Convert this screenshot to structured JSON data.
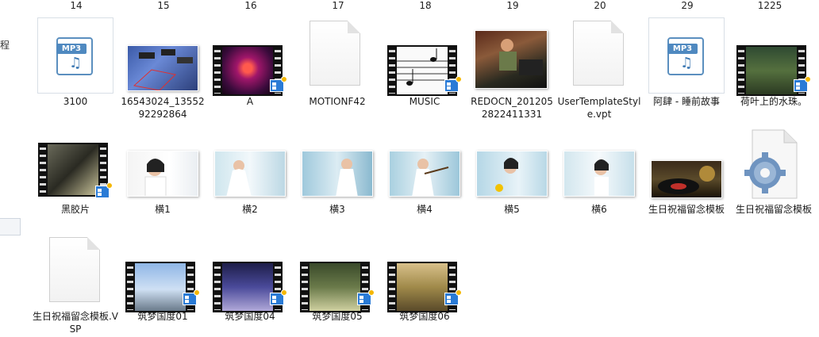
{
  "sidebar": {
    "partial_char": "程"
  },
  "header_numbers": [
    "14",
    "15",
    "16",
    "17",
    "18",
    "19",
    "20",
    "29",
    "1225"
  ],
  "files": [
    {
      "name": "3100",
      "icon": "mp3-file-icon"
    },
    {
      "name": "16543024_1355292292864",
      "icon": "image-thumbnail"
    },
    {
      "name": "A",
      "icon": "video-thumbnail"
    },
    {
      "name": "MOTIONF42",
      "icon": "blank-document-icon"
    },
    {
      "name": "MUSIC",
      "icon": "video-thumbnail"
    },
    {
      "name": "REDOCN_2012052822411331",
      "icon": "image-thumbnail"
    },
    {
      "name": "UserTemplateStyle.vpt",
      "icon": "blank-document-icon"
    },
    {
      "name": "阿肆 - 睡前故事",
      "icon": "mp3-file-icon"
    },
    {
      "name": "荷叶上的水珠。",
      "icon": "video-thumbnail"
    },
    {
      "name": "黑胶片",
      "icon": "video-thumbnail"
    },
    {
      "name": "横1",
      "icon": "image-thumbnail"
    },
    {
      "name": "横2",
      "icon": "image-thumbnail"
    },
    {
      "name": "横3",
      "icon": "image-thumbnail"
    },
    {
      "name": "横4",
      "icon": "image-thumbnail"
    },
    {
      "name": "横5",
      "icon": "image-thumbnail"
    },
    {
      "name": "横6",
      "icon": "image-thumbnail"
    },
    {
      "name": "生日祝福留念模板",
      "icon": "image-thumbnail"
    },
    {
      "name": "生日祝福留念模板",
      "icon": "gear-file-icon"
    },
    {
      "name": "生日祝福留念模板.VSP",
      "icon": "blank-document-icon"
    },
    {
      "name": "筑梦国度01",
      "icon": "video-thumbnail"
    },
    {
      "name": "筑梦国度04",
      "icon": "video-thumbnail"
    },
    {
      "name": "筑梦国度05",
      "icon": "video-thumbnail"
    },
    {
      "name": "筑梦国度06",
      "icon": "video-thumbnail"
    }
  ],
  "mp3_tag": "MP3",
  "colors": {
    "selection_blue": "#2a7bd6",
    "badge_gold": "#f5b700",
    "mp3_blue": "#4f89c0"
  }
}
